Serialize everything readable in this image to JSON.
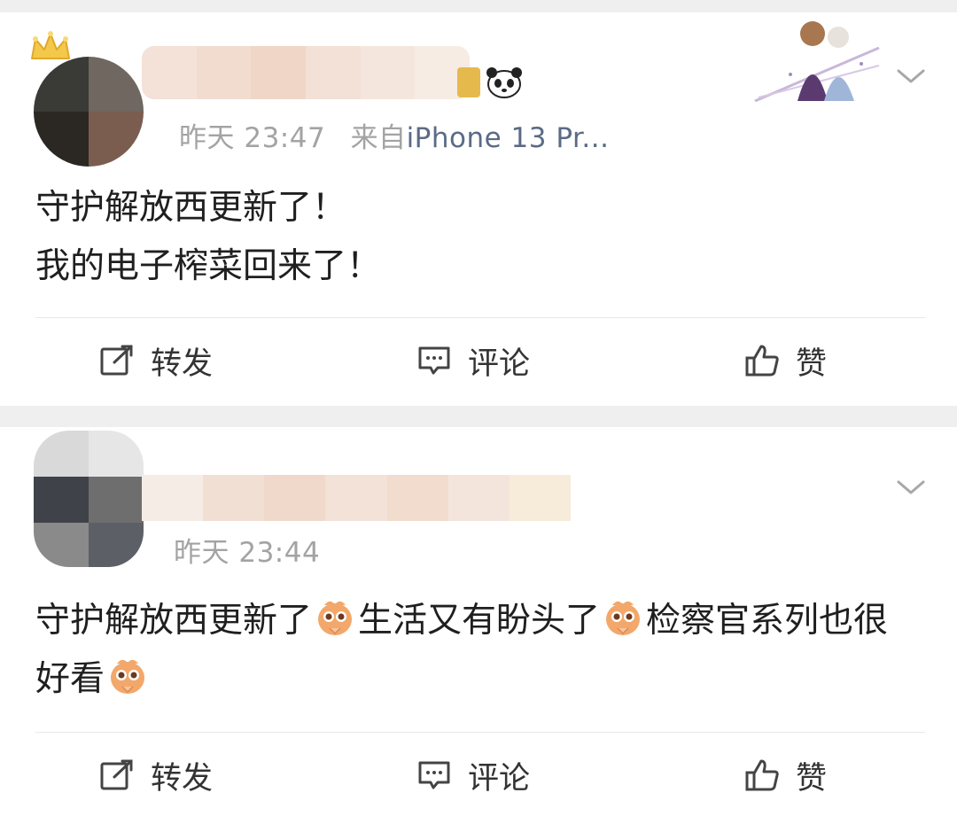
{
  "posts": [
    {
      "time": "昨天 23:47",
      "source_label": "来自",
      "source": "iPhone 13 Pr...",
      "lines": [
        "守护解放西更新了！",
        "我的电子榨菜回来了！"
      ],
      "actions": {
        "repost": "转发",
        "comment": "评论",
        "like": "赞"
      }
    },
    {
      "time": "昨天 23:44",
      "content_parts": [
        "守护解放西更新了",
        "生活又有盼头了",
        "检察官系列也很好看"
      ],
      "actions": {
        "repost": "转发",
        "comment": "评论",
        "like": "赞"
      }
    }
  ],
  "icons": {
    "crown": "crown-icon",
    "panda": "panda-badge-icon",
    "more": "chevron-down-icon",
    "repost": "repost-icon",
    "comment": "comment-icon",
    "like": "thumbs-up-icon",
    "emoji": "pray-face-emoji-icon"
  },
  "colors": {
    "source_link": "#5b6b86",
    "meta_gray": "#a3a3a3",
    "divider": "#e8e8e8",
    "page_bg": "#efefef"
  }
}
